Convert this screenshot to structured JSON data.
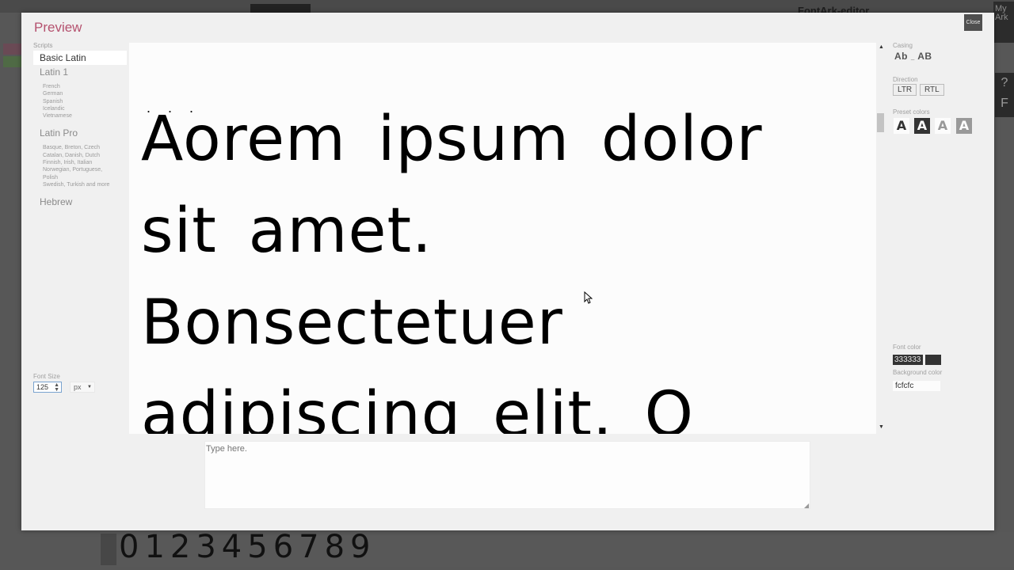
{
  "background_app": {
    "title": "FontArk-editor",
    "my_ark": "My Ark",
    "side_buttons": [
      "?",
      "F"
    ],
    "digits": "0123456789"
  },
  "modal": {
    "title": "Preview",
    "close_label": "Close"
  },
  "scripts": {
    "label": "Scripts",
    "items": [
      {
        "label": "Basic Latin",
        "active": true,
        "languages": []
      },
      {
        "label": "Latin 1",
        "active": false,
        "languages": [
          "French",
          "German",
          "Spanish",
          "Icelandic",
          "Vietnamese"
        ]
      },
      {
        "label": "Latin Pro",
        "active": false,
        "languages": [
          "Basque, Breton, Czech",
          "Catalan, Danish, Dutch",
          "Finnish, Irish, Italian",
          "Norwegian, Portuguese,",
          "Polish",
          "Swedish, Turkish and more"
        ]
      },
      {
        "label": "Hebrew",
        "active": false,
        "languages": []
      }
    ]
  },
  "font_size": {
    "label": "Font Size",
    "value": "125",
    "unit": "px"
  },
  "preview": {
    "dots": "...",
    "text": "Aorem ipsum dolor sit amet. Bonsectetuer adipiscing elit. Q"
  },
  "input": {
    "placeholder": "Type here."
  },
  "casing": {
    "label": "Casing",
    "mixed": "Ab",
    "separator": "_",
    "upper": "AB"
  },
  "direction": {
    "label": "Direction",
    "options": [
      "LTR",
      "RTL"
    ]
  },
  "preset_colors": {
    "label": "Preset colors",
    "presets": [
      {
        "glyph": "A",
        "fg": "#333333",
        "bg": "#fcfcfc"
      },
      {
        "glyph": "A",
        "fg": "#fcfcfc",
        "bg": "#333333"
      },
      {
        "glyph": "A",
        "fg": "#999999",
        "bg": "#fcfcfc"
      },
      {
        "glyph": "A",
        "fg": "#fcfcfc",
        "bg": "#999999"
      }
    ]
  },
  "font_color": {
    "label": "Font color",
    "value": "333333",
    "swatch": "#333333"
  },
  "background_color": {
    "label": "Background color",
    "value": "fcfcfc",
    "swatch": "#fcfcfc"
  },
  "colors": {
    "title_accent": "#b5526f"
  }
}
